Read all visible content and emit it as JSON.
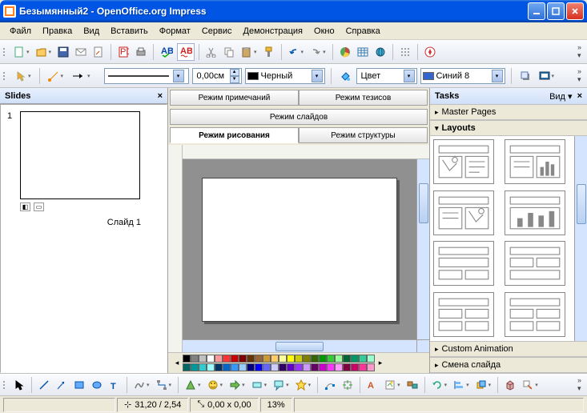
{
  "window": {
    "title": "Безымянный2 - OpenOffice.org Impress"
  },
  "menu": [
    "Файл",
    "Правка",
    "Вид",
    "Вставить",
    "Формат",
    "Сервис",
    "Демонстрация",
    "Окно",
    "Справка"
  ],
  "toolbar2": {
    "line_width": "0,00см",
    "line_color_label": "Черный",
    "fill_type": "Цвет",
    "fill_color": "Синий 8"
  },
  "slides_panel": {
    "title": "Slides",
    "slide_num": "1",
    "slide_label": "Слайд 1"
  },
  "view_tabs": {
    "notes": "Режим примечаний",
    "outline2": "Режим тезисов",
    "slides": "Режим слайдов",
    "drawing": "Режим рисования",
    "structure": "Режим структуры"
  },
  "tasks": {
    "title": "Tasks",
    "view_label": "Вид",
    "master_pages": "Master Pages",
    "layouts": "Layouts",
    "custom_anim": "Custom Animation",
    "slide_change": "Смена слайда"
  },
  "status": {
    "pos": "31,20 / 2,54",
    "size": "0,00 x 0,00",
    "zoom": "13%"
  },
  "palette_colors": [
    "#000000",
    "#808080",
    "#c0c0c0",
    "#ffffff",
    "#ff9999",
    "#ff3333",
    "#cc0000",
    "#800000",
    "#663300",
    "#996633",
    "#cc9933",
    "#ffcc66",
    "#ffff99",
    "#ffff00",
    "#cccc00",
    "#808000",
    "#336600",
    "#009900",
    "#33cc33",
    "#99ff99",
    "#006633",
    "#009966",
    "#33cc99",
    "#99ffcc",
    "#006666",
    "#009999",
    "#33cccc",
    "#99ffff",
    "#003366",
    "#0066cc",
    "#3399ff",
    "#99ccff",
    "#000080",
    "#0000ff",
    "#6666ff",
    "#ccccff",
    "#330066",
    "#6600cc",
    "#9933ff",
    "#cc99ff",
    "#660066",
    "#cc00cc",
    "#ff33ff",
    "#ff99ff",
    "#800040",
    "#cc0066",
    "#ff3399",
    "#ff99cc"
  ]
}
